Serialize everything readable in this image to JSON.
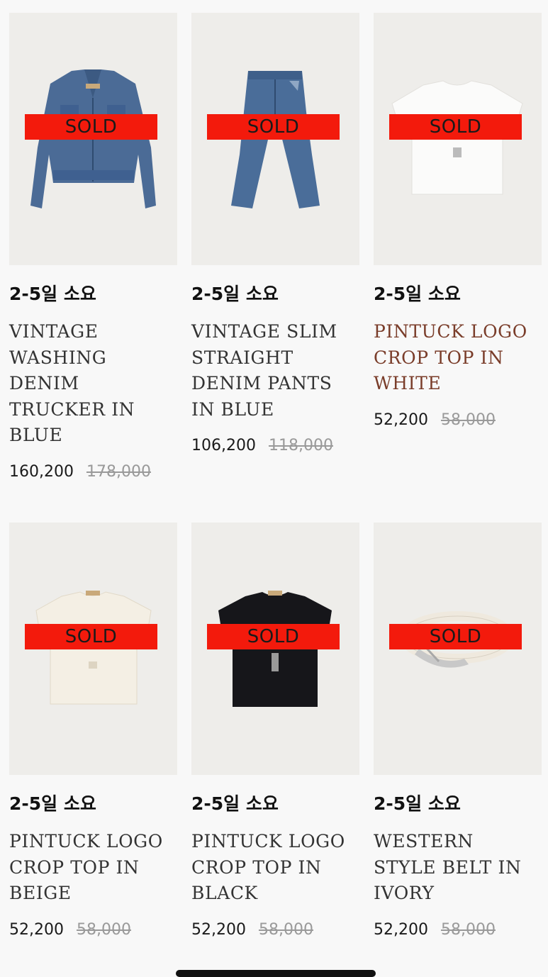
{
  "products": [
    {
      "badge": "SOLD",
      "shipping": "2-5일 소요",
      "name_lines": [
        "VINTAGE",
        "WASHING",
        "DENIM",
        "TRUCKER IN",
        "BLUE"
      ],
      "price": "160,200",
      "original_price": "178,000",
      "image_icon": "denim-jacket-image",
      "highlight": false
    },
    {
      "badge": "SOLD",
      "shipping": "2-5일 소요",
      "name_lines": [
        "VINTAGE SLIM",
        "STRAIGHT",
        "DENIM PANTS",
        "IN BLUE"
      ],
      "price": "106,200",
      "original_price": "118,000",
      "image_icon": "denim-pants-image",
      "highlight": false
    },
    {
      "badge": "SOLD",
      "shipping": "2-5일 소요",
      "name_lines": [
        "PINTUCK LOGO",
        "CROP TOP IN",
        "WHITE"
      ],
      "price": "52,200",
      "original_price": "58,000",
      "image_icon": "white-crop-top-image",
      "highlight": true,
      "highlight_color": "#7a3d2a"
    },
    {
      "badge": "SOLD",
      "shipping": "2-5일 소요",
      "name_lines": [
        "PINTUCK LOGO",
        "CROP TOP IN",
        "BEIGE"
      ],
      "price": "52,200",
      "original_price": "58,000",
      "image_icon": "beige-crop-top-image",
      "highlight": false
    },
    {
      "badge": "SOLD",
      "shipping": "2-5일 소요",
      "name_lines": [
        "PINTUCK LOGO",
        "CROP TOP IN",
        "BLACK"
      ],
      "price": "52,200",
      "original_price": "58,000",
      "image_icon": "black-crop-top-image",
      "highlight": false
    },
    {
      "badge": "SOLD",
      "shipping": "2-5일 소요",
      "name_lines": [
        "WESTERN",
        "STYLE BELT IN",
        "IVORY"
      ],
      "price": "52,200",
      "original_price": "58,000",
      "image_icon": "ivory-belt-image",
      "highlight": false
    }
  ],
  "colors": {
    "sold_badge": "#f31a0c",
    "thumbnail_bg": "#eeedea",
    "page_bg": "#f8f8f8",
    "strikethrough_price": "#9a9a9a"
  }
}
